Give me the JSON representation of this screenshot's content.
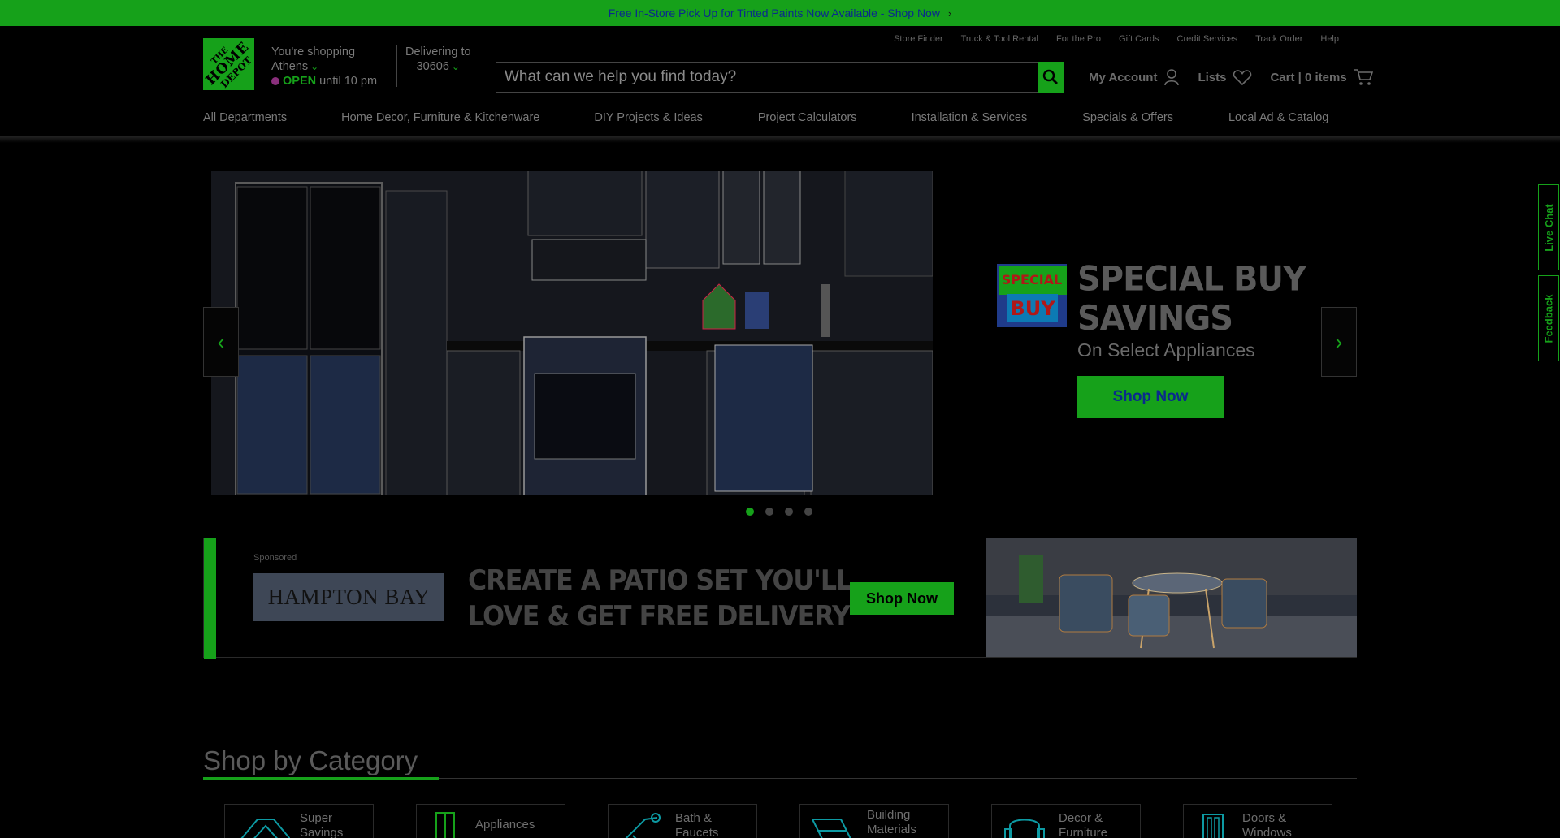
{
  "promo": {
    "text": "Free In-Store Pick Up for Tinted Paints Now Available - Shop Now"
  },
  "logo": {
    "line1": "THE",
    "line2": "HOME",
    "line3": "DEPOT"
  },
  "store": {
    "label": "You're shopping",
    "city": "Athens",
    "open": "OPEN",
    "hours": "until 10 pm"
  },
  "delivery": {
    "label": "Delivering to",
    "zip": "30606"
  },
  "search": {
    "placeholder": "What can we help you find today?"
  },
  "utility_links": [
    "Store Finder",
    "Truck & Tool Rental",
    "For the Pro",
    "Gift Cards",
    "Credit Services",
    "Track Order",
    "Help"
  ],
  "account": {
    "my_account": "My Account",
    "lists": "Lists",
    "cart": "Cart | 0 items"
  },
  "nav": [
    "All Departments",
    "Home Decor, Furniture & Kitchenware",
    "DIY Projects & Ideas",
    "Project Calculators",
    "Installation & Services",
    "Specials & Offers",
    "Local Ad & Catalog"
  ],
  "hero": {
    "badge_top": "SPECIAL",
    "badge_bottom": "BUY",
    "title_line1": "SPECIAL BUY",
    "title_line2": "SAVINGS",
    "subtitle": "On Select Appliances",
    "button": "Shop Now",
    "slides": 4,
    "active_slide": 1
  },
  "sponsored": {
    "label": "Sponsored",
    "brand": "HAMPTON BAY",
    "headline1": "CREATE A PATIO SET YOU'LL",
    "headline2": "LOVE & GET FREE DELIVERY",
    "button": "Shop Now"
  },
  "categories": {
    "title": "Shop by Category",
    "items": [
      {
        "label": "Super Savings",
        "icon": "tag-icon"
      },
      {
        "label": "Appliances",
        "icon": "refrigerator-icon"
      },
      {
        "label": "Bath & Faucets",
        "icon": "shower-icon"
      },
      {
        "label": "Building Materials",
        "icon": "lumber-icon"
      },
      {
        "label": "Decor & Furniture",
        "icon": "chair-icon"
      },
      {
        "label": "Doors & Windows",
        "icon": "door-icon"
      }
    ]
  },
  "side_tabs": {
    "chat": "Live Chat",
    "feedback": "Feedback"
  },
  "colors": {
    "brand_green": "#16a11a",
    "background": "#000000",
    "link_blue": "#0a2a8c"
  }
}
